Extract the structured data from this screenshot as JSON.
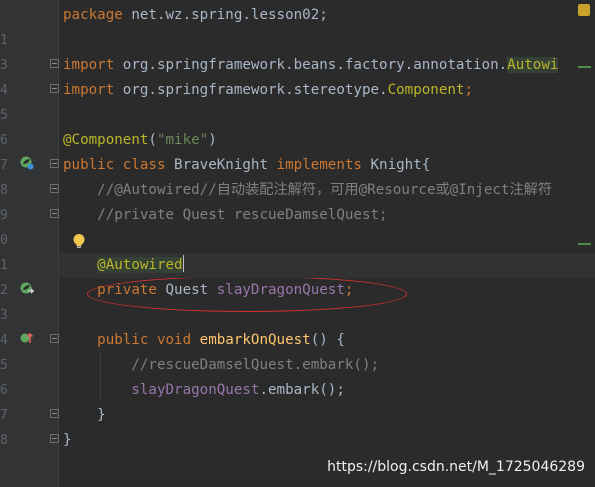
{
  "editor": {
    "lines": [
      {
        "num": "",
        "tokens": [
          {
            "t": "package",
            "c": "kw"
          },
          {
            "t": " net.wz.spring.lesson02;",
            "c": "plain"
          }
        ]
      },
      {
        "num": "1",
        "tokens": []
      },
      {
        "num": "3",
        "tokens": [
          {
            "t": "import",
            "c": "kw"
          },
          {
            "t": " org.springframework.beans.factory.annotation.",
            "c": "plain"
          },
          {
            "t": "Autowi",
            "c": "ann hl-bg"
          }
        ]
      },
      {
        "num": "4",
        "tokens": [
          {
            "t": "import",
            "c": "kw"
          },
          {
            "t": " org.springframework.stereotype.",
            "c": "plain"
          },
          {
            "t": "Component",
            "c": "ann"
          },
          {
            "t": ";",
            "c": "kw"
          }
        ]
      },
      {
        "num": "5",
        "tokens": []
      },
      {
        "num": "6",
        "tokens": [
          {
            "t": "@Component",
            "c": "ann"
          },
          {
            "t": "(",
            "c": "plain"
          },
          {
            "t": "\"mike\"",
            "c": "str"
          },
          {
            "t": ")",
            "c": "plain"
          }
        ]
      },
      {
        "num": "7",
        "tokens": [
          {
            "t": "public class ",
            "c": "kw"
          },
          {
            "t": "BraveKnight ",
            "c": "cls"
          },
          {
            "t": "implements ",
            "c": "kw"
          },
          {
            "t": "Knight{",
            "c": "plain"
          }
        ]
      },
      {
        "num": "8",
        "tokens": [
          {
            "t": "    //@Autowired//自动装配注解符，可用@Resource或@Inject注解符",
            "c": "cmt"
          }
        ]
      },
      {
        "num": "9",
        "tokens": [
          {
            "t": "    //private Quest rescueDamselQuest;",
            "c": "cmt"
          }
        ]
      },
      {
        "num": "0",
        "tokens": []
      },
      {
        "num": "1",
        "tokens": [
          {
            "t": "    ",
            "c": "plain"
          },
          {
            "t": "@Autowired",
            "c": "ann hl-bg"
          }
        ]
      },
      {
        "num": "2",
        "tokens": [
          {
            "t": "    ",
            "c": "plain"
          },
          {
            "t": "private ",
            "c": "kw"
          },
          {
            "t": "Quest ",
            "c": "plain"
          },
          {
            "t": "slayDragonQuest",
            "c": "field"
          },
          {
            "t": ";",
            "c": "kw"
          }
        ]
      },
      {
        "num": "3",
        "tokens": []
      },
      {
        "num": "4",
        "tokens": [
          {
            "t": "    ",
            "c": "plain"
          },
          {
            "t": "public void ",
            "c": "kw"
          },
          {
            "t": "embarkOnQuest",
            "c": "method"
          },
          {
            "t": "() {",
            "c": "plain"
          }
        ]
      },
      {
        "num": "5",
        "tokens": [
          {
            "t": "        //rescueDamselQuest.embark();",
            "c": "cmt"
          }
        ]
      },
      {
        "num": "6",
        "tokens": [
          {
            "t": "        ",
            "c": "plain"
          },
          {
            "t": "slayDragonQuest",
            "c": "field"
          },
          {
            "t": ".embark();",
            "c": "plain"
          }
        ]
      },
      {
        "num": "7",
        "tokens": [
          {
            "t": "    }",
            "c": "plain"
          }
        ]
      },
      {
        "num": "8",
        "tokens": [
          {
            "t": "}",
            "c": "plain"
          }
        ]
      }
    ]
  },
  "gutter_icons": [
    "spring-bean-icon",
    "implementing-method-icon",
    "autowired-navigate-icon",
    "override-icon"
  ],
  "watermark": "https://blog.csdn.net/M_1725046289",
  "colors": {
    "background": "#2b2b2b",
    "gutter": "#313335",
    "keyword": "#cc7832",
    "annotation": "#bbb529",
    "string": "#6a8759",
    "field": "#9876aa",
    "method": "#ffc66d",
    "comment": "#808080",
    "highlight_ellipse": "#d0312d"
  }
}
